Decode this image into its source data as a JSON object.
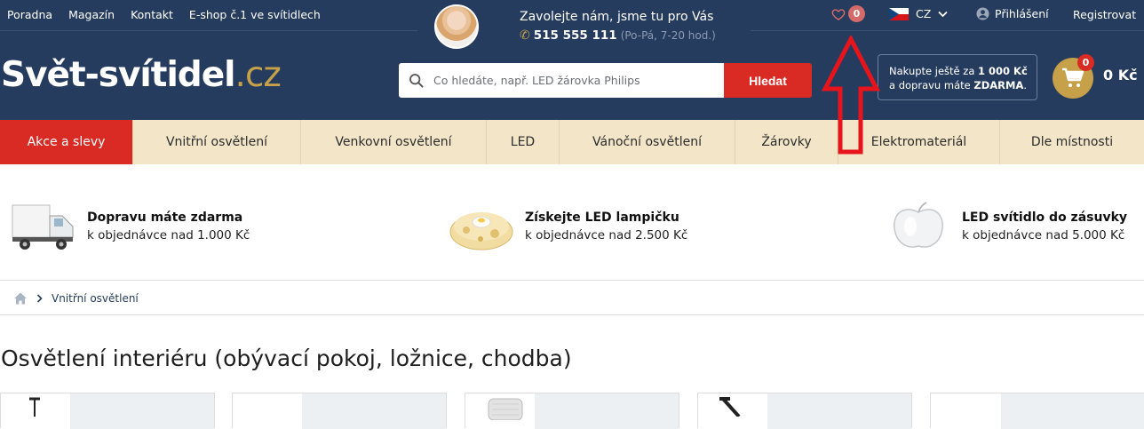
{
  "top_links": [
    "Poradna",
    "Magazín",
    "Kontakt",
    "E-shop č.1 ve svítidlech"
  ],
  "contact": {
    "title": "Zavolejte nám, jsme tu pro Vás",
    "phone": "515 555 111",
    "hours": "(Po-Pá, 7-20 hod.)"
  },
  "wishlist": {
    "count": "0",
    "icon": "heart-icon"
  },
  "language": {
    "code": "CZ",
    "flag": "czech-flag"
  },
  "account": {
    "login": "Přihlášení",
    "register": "Registrovat"
  },
  "logo": {
    "name": "Svět-svítidel",
    "tld": ".cz"
  },
  "search": {
    "placeholder": "Co hledáte, např. LED žárovka Philips",
    "button": "Hledat"
  },
  "free_shipping": {
    "line1_prefix": "Nakupte ještě za ",
    "line1_amount": "1 000 Kč",
    "line2_prefix": "a dopravu máte ",
    "line2_strong": "ZDARMA",
    "line2_suffix": "."
  },
  "cart": {
    "count": "0",
    "total": "0 Kč"
  },
  "nav": [
    "Akce a slevy",
    "Vnitřní osvětlení",
    "Venkovní osvětlení",
    "LED",
    "Vánoční osvětlení",
    "Žárovky",
    "Elektromateriál",
    "Dle místnosti"
  ],
  "benefits": [
    {
      "title": "Dopravu máte zdarma",
      "sub": "k objednávce nad 1.000 Kč"
    },
    {
      "title": "Získejte LED lampičku",
      "sub": "k objednávce nad 2.500 Kč"
    },
    {
      "title": "LED svítidlo do zásuvky",
      "sub": "k objednávce nad 5.000 Kč"
    }
  ],
  "breadcrumb": {
    "current": "Vnitřní osvětlení"
  },
  "page_title": "Osvětlení interiéru (obývací pokoj, ložnice, chodba)",
  "colors": {
    "header": "#253c5e",
    "accent_red": "#d92b24",
    "gold": "#c7a14a",
    "nav_bg": "#f3e5c8"
  }
}
